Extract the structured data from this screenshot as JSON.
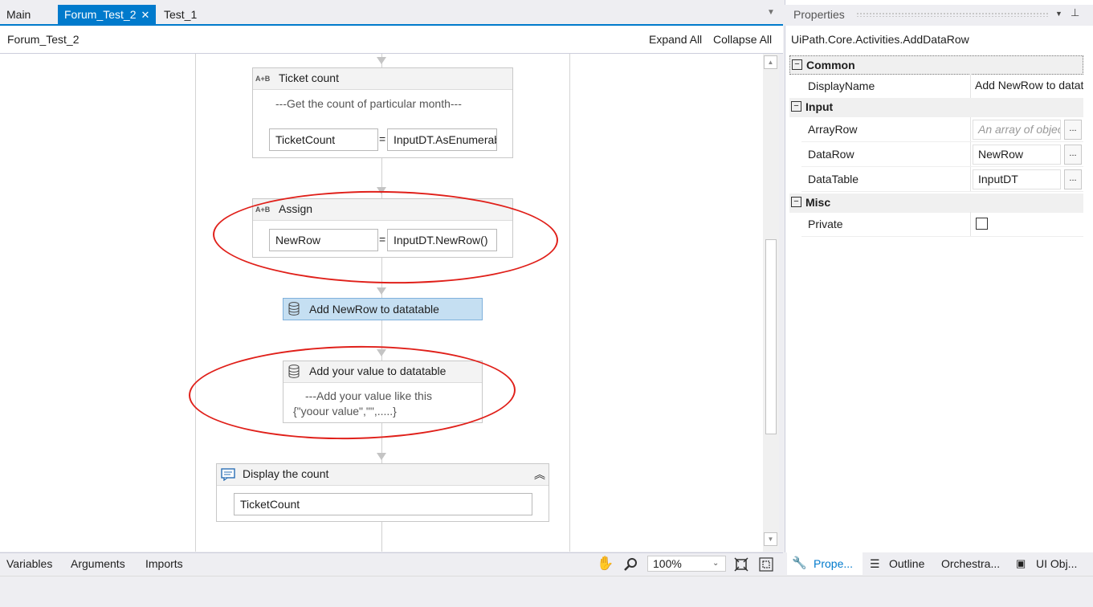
{
  "tabs": [
    "Main",
    "Forum_Test_2",
    "Test_1"
  ],
  "active_tab": "Forum_Test_2",
  "tab_close": "✕",
  "breadcrumb": "Forum_Test_2",
  "expand_all": "Expand All",
  "collapse_all": "Collapse All",
  "activities": {
    "ticket_count": {
      "title": "Ticket count",
      "comment": "---Get the count of particular month---",
      "to": "TicketCount",
      "value": "InputDT.AsEnumerable"
    },
    "assign": {
      "title": "Assign",
      "to": "NewRow",
      "value": "InputDT.NewRow()"
    },
    "add_newrow": {
      "title": "Add NewRow to  datatable"
    },
    "add_value": {
      "title": "Add your value to datatable",
      "comment_line1": "---Add your value like this",
      "comment_line2": "{\"yoour value\",\"\",.....}"
    },
    "display": {
      "title": "Display the count",
      "message": "TicketCount"
    }
  },
  "ab_icon": "A+B",
  "bottom_tabs": [
    "Variables",
    "Arguments",
    "Imports"
  ],
  "zoom": "100%",
  "properties": {
    "title": "Properties",
    "type": "UiPath.Core.Activities.AddDataRow",
    "categories": {
      "common": "Common",
      "input": "Input",
      "misc": "Misc"
    },
    "rows": {
      "display_name": {
        "name": "DisplayName",
        "value": "Add NewRow to  datatable"
      },
      "array_row": {
        "name": "ArrayRow",
        "placeholder": "An array of objects"
      },
      "data_row": {
        "name": "DataRow",
        "value": "NewRow"
      },
      "data_table": {
        "name": "DataTable",
        "value": "InputDT"
      },
      "private": {
        "name": "Private",
        "checked": false
      }
    },
    "ellipsis": "..."
  },
  "panel_tabs": [
    "Prope...",
    "Outline",
    "Orchestra...",
    "UI Obj..."
  ],
  "colors": {
    "accent": "#007acc",
    "annotation": "#e0201a",
    "selected": "#c5dff2"
  }
}
